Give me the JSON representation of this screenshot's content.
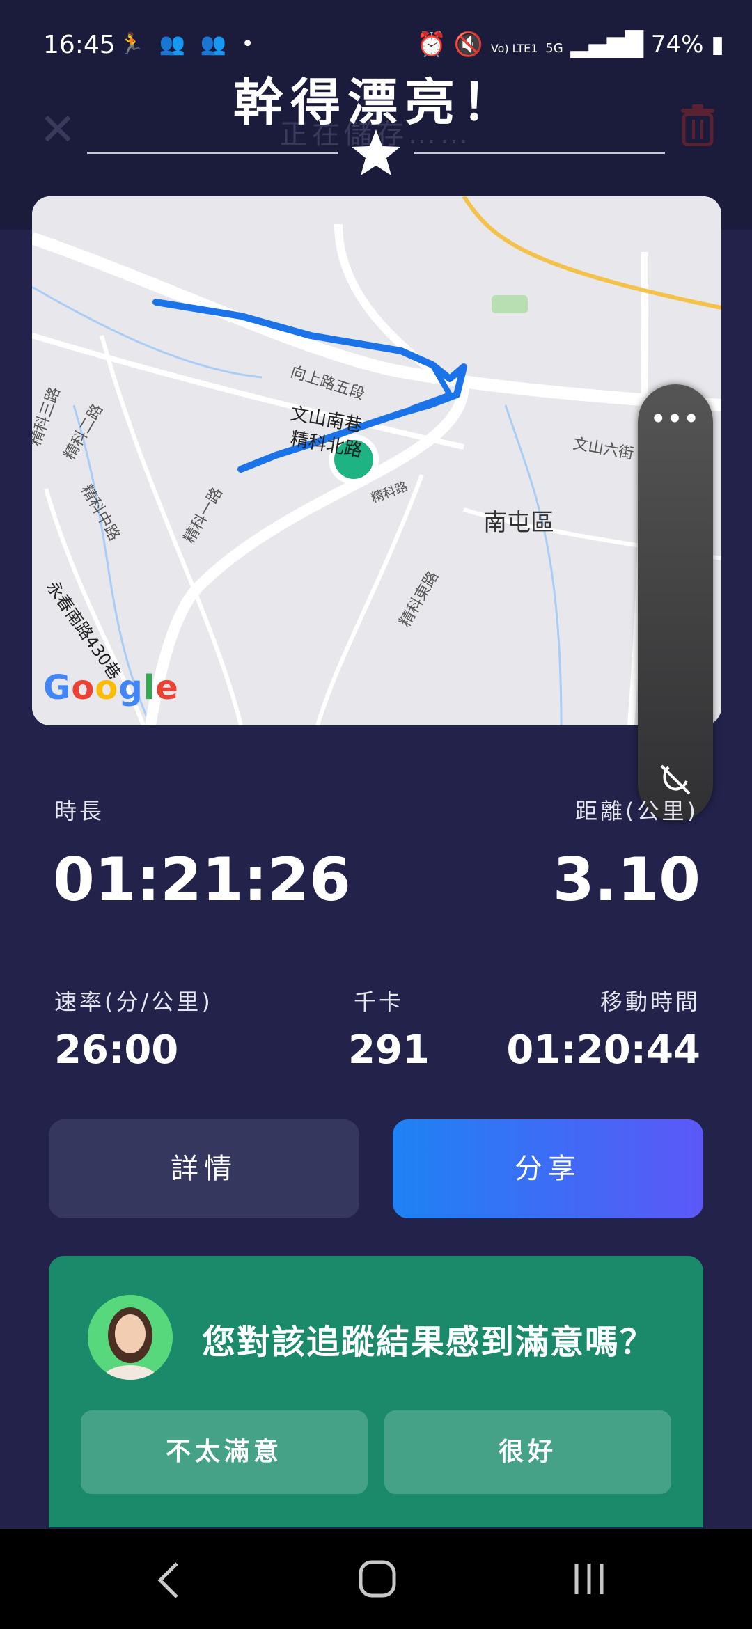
{
  "status_bar": {
    "time": "16:45",
    "left_icons": [
      "running-icon",
      "people-icon",
      "people-icon",
      "dot-icon"
    ],
    "right_icons": [
      "alarm-icon",
      "mute-icon",
      "volte-icon",
      "5g-icon",
      "signal-icon"
    ],
    "network_label": "Vo) LTE1",
    "network_type": "5G",
    "battery": "74%"
  },
  "header": {
    "title": "幹得漂亮！",
    "saving_text": "正在儲存……"
  },
  "map": {
    "labels": {
      "road_1": "向上路五段",
      "road_2": "文山南巷",
      "road_3": "精科北路",
      "road_4": "文山六街",
      "road_5": "精科二路",
      "road_6": "精科一路",
      "road_7": "精科中路",
      "road_8": "精科東路",
      "road_9": "永春南路430巷",
      "road_10": "精科三路",
      "road_11": "精科路",
      "district": "南屯區"
    },
    "attribution": "Google",
    "brand_colors": [
      "#4285F4",
      "#EA4335",
      "#FBBC05",
      "#4285F4",
      "#34A853",
      "#EA4335"
    ],
    "route_color": "#1a73e8",
    "end_marker_color": "#1db382"
  },
  "floating_panel": {
    "menu": "•••",
    "icon": "floating-off-icon"
  },
  "stats": {
    "duration_label": "時長",
    "duration_value": "01:21:26",
    "distance_label": "距離(公里)",
    "distance_value": "3.10",
    "pace_label": "速率(分/公里)",
    "pace_value": "26:00",
    "calories_label": "千卡",
    "calories_value": "291",
    "moving_label": "移動時間",
    "moving_value": "01:20:44"
  },
  "buttons": {
    "details": "詳情",
    "share": "分享"
  },
  "feedback": {
    "question": "您對該追蹤結果感到滿意嗎？",
    "not_satisfied": "不太滿意",
    "good": "很好"
  },
  "nav": {
    "back": "back-icon",
    "home": "home-icon",
    "recents": "recents-icon"
  },
  "colors": {
    "background": "#22224b",
    "share_gradient_start": "#1d82f4",
    "share_gradient_end": "#5c58f7",
    "card": "#1a8a6a"
  }
}
